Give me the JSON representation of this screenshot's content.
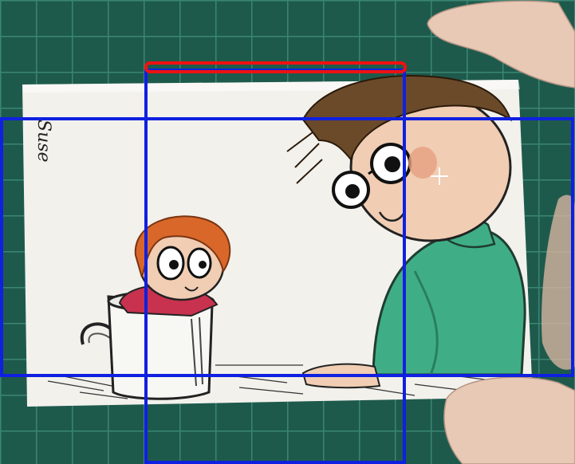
{
  "photo": {
    "subject": "watercolor-ink-illustration-card-held-in-hand",
    "signature": "Suse"
  },
  "colors": {
    "cutting_mat": "#1e5a4c",
    "grid_line": "#3f8d7a",
    "paper": "#f2f1ec",
    "skin": "#f0cdb3",
    "hair_brown": "#6b4a2a",
    "hair_orange": "#d9672a",
    "sweater_green": "#3fae86",
    "child_top_red": "#c8324e",
    "overlay_blue": "#1020e0",
    "overlay_red": "#ee1111",
    "crosshair": "#ffffff"
  },
  "overlays": [
    {
      "name": "blue-box-horizontal",
      "color": "blue"
    },
    {
      "name": "blue-box-vertical",
      "color": "blue"
    },
    {
      "name": "red-bar-top",
      "color": "red"
    },
    {
      "name": "crosshair-marker",
      "color": "white"
    }
  ]
}
